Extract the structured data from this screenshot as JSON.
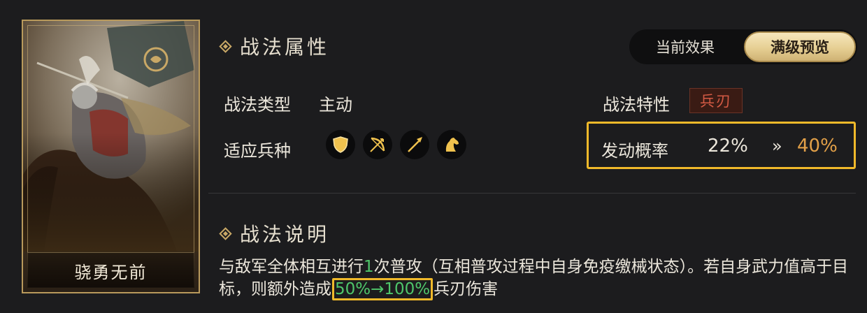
{
  "card": {
    "name": "骁勇无前"
  },
  "attributes": {
    "title": "战法属性",
    "toggle": {
      "off_label": "当前效果",
      "on_label": "满级预览"
    },
    "type_label": "战法类型",
    "type_value": "主动",
    "trait_label": "战法特性",
    "trait_value": "兵刃",
    "troops_label": "适应兵种",
    "troop_icons": [
      "shield-icon",
      "bow-icon",
      "spear-icon",
      "horse-icon"
    ],
    "rate_label": "发动概率",
    "rate_current": "22%",
    "rate_arrow": "»",
    "rate_max": "40%"
  },
  "description": {
    "title": "战法说明",
    "part1": "与敌军全体相互进行",
    "count": "1",
    "part2": "次普攻（互相普攻过程中自身免疫缴械状态）。若自身武力值高于目标，则额外造成",
    "damage_range": "50%→100%",
    "part3": "兵刃伤害"
  },
  "colors": {
    "accent_gold": "#f0b92a",
    "highlight_green": "#4fc66a",
    "max_value_orange": "#e2a048",
    "trait_red": "#d45a44"
  }
}
